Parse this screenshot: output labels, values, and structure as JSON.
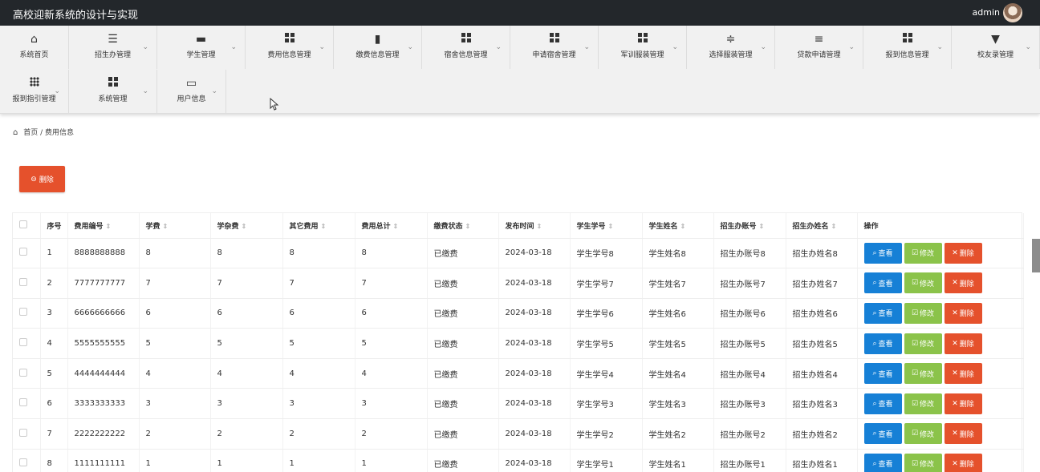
{
  "header": {
    "app_title": "高校迎新系统的设计与实现",
    "user": "admin"
  },
  "menu": [
    {
      "label": "系统首页",
      "icon": "home-icon",
      "home": true
    },
    {
      "label": "招生办管理",
      "icon": "list-icon"
    },
    {
      "label": "学生管理",
      "icon": "briefcase-icon"
    },
    {
      "label": "费用信息管理",
      "icon": "grid-icon"
    },
    {
      "label": "缴费信息管理",
      "icon": "book-icon"
    },
    {
      "label": "宿舍信息管理",
      "icon": "grid-icon"
    },
    {
      "label": "申请宿舍管理",
      "icon": "grid-icon"
    },
    {
      "label": "军训服装管理",
      "icon": "grid-icon"
    },
    {
      "label": "选择服装管理",
      "icon": "sliders-icon"
    },
    {
      "label": "贷款申请管理",
      "icon": "align-icon"
    },
    {
      "label": "报到信息管理",
      "icon": "grid-icon"
    },
    {
      "label": "校友录管理",
      "icon": "brush-icon"
    },
    {
      "label": "报到指引管理",
      "icon": "grid9-icon"
    },
    {
      "label": "系统管理",
      "icon": "grid-icon"
    },
    {
      "label": "用户信息",
      "icon": "wallet-icon"
    }
  ],
  "breadcrumb": {
    "home": "首页",
    "sep": "/",
    "current": "费用信息"
  },
  "toolbar": {
    "delete_label": "删除"
  },
  "table": {
    "headers": [
      "序号",
      "费用编号",
      "学费",
      "学杂费",
      "其它费用",
      "费用总计",
      "缴费状态",
      "发布时间",
      "学生学号",
      "学生姓名",
      "招生办账号",
      "招生办姓名",
      "操作"
    ],
    "actions": {
      "view": "查看",
      "edit": "修改",
      "delete": "删除"
    },
    "rows": [
      [
        "1",
        "8888888888",
        "8",
        "8",
        "8",
        "8",
        "已缴费",
        "2024-03-18",
        "学生学号8",
        "学生姓名8",
        "招生办账号8",
        "招生办姓名8"
      ],
      [
        "2",
        "7777777777",
        "7",
        "7",
        "7",
        "7",
        "已缴费",
        "2024-03-18",
        "学生学号7",
        "学生姓名7",
        "招生办账号7",
        "招生办姓名7"
      ],
      [
        "3",
        "6666666666",
        "6",
        "6",
        "6",
        "6",
        "已缴费",
        "2024-03-18",
        "学生学号6",
        "学生姓名6",
        "招生办账号6",
        "招生办姓名6"
      ],
      [
        "4",
        "5555555555",
        "5",
        "5",
        "5",
        "5",
        "已缴费",
        "2024-03-18",
        "学生学号5",
        "学生姓名5",
        "招生办账号5",
        "招生办姓名5"
      ],
      [
        "5",
        "4444444444",
        "4",
        "4",
        "4",
        "4",
        "已缴费",
        "2024-03-18",
        "学生学号4",
        "学生姓名4",
        "招生办账号4",
        "招生办姓名4"
      ],
      [
        "6",
        "3333333333",
        "3",
        "3",
        "3",
        "3",
        "已缴费",
        "2024-03-18",
        "学生学号3",
        "学生姓名3",
        "招生办账号3",
        "招生办姓名3"
      ],
      [
        "7",
        "2222222222",
        "2",
        "2",
        "2",
        "2",
        "已缴费",
        "2024-03-18",
        "学生学号2",
        "学生姓名2",
        "招生办账号2",
        "招生办姓名2"
      ],
      [
        "8",
        "1111111111",
        "1",
        "1",
        "1",
        "1",
        "已缴费",
        "2024-03-18",
        "学生学号1",
        "学生姓名1",
        "招生办账号1",
        "招生办姓名1"
      ]
    ]
  },
  "colors": {
    "topbar": "#23272b",
    "danger": "#e5512c",
    "primary": "#1680d6",
    "success": "#8bc34a"
  }
}
